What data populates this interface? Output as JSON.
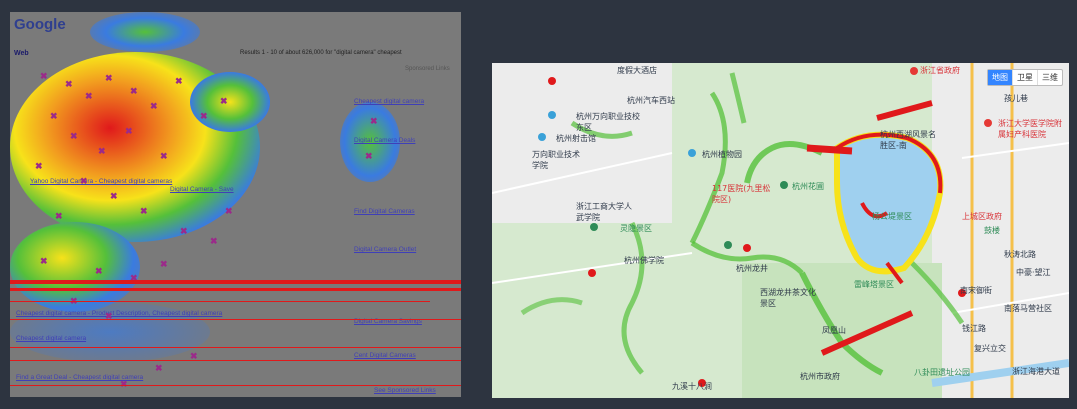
{
  "left": {
    "logo": "Google",
    "web_label": "Web",
    "results_info": "Results 1 - 10 of about 626,000 for \"digital camera\" cheapest",
    "sponsored_label": "Sponsored Links",
    "results": [
      "Yahoo Digital Camera - Cheapest digital cameras",
      "Digital Camera - Save",
      "Cheapest digital camera - Product Description, Cheapest digital camera",
      "Cheapest digital camera",
      "Find a Great Deal - Cheapest digital camera",
      "See Sponsored Links"
    ],
    "ads": [
      "Cheapest digital camera",
      "Digital Camera Deals",
      "Find Digital Cameras",
      "Digital Camera Outlet",
      "Digital Camera Savings",
      "Cent Digital Cameras"
    ]
  },
  "right": {
    "map_modes": [
      "地图",
      "卫星",
      "三维"
    ],
    "labels": [
      {
        "text": "度假大酒店",
        "cls": ""
      },
      {
        "text": "浙江省政府",
        "cls": "red"
      },
      {
        "text": "杭州万向职业技校东区",
        "cls": ""
      },
      {
        "text": "杭州汽车西站",
        "cls": ""
      },
      {
        "text": "杭州射击馆",
        "cls": ""
      },
      {
        "text": "万向职业技术学院",
        "cls": ""
      },
      {
        "text": "杭州植物园",
        "cls": ""
      },
      {
        "text": "杭州西湖风景名胜区-南",
        "cls": ""
      },
      {
        "text": "浙江大学医学院附属妇产科医院",
        "cls": "red"
      },
      {
        "text": "孩儿巷",
        "cls": ""
      },
      {
        "text": "浙江工商大学人武学院",
        "cls": ""
      },
      {
        "text": "灵隐景区",
        "cls": "green"
      },
      {
        "text": "117医院(九里松院区)",
        "cls": "red"
      },
      {
        "text": "杭州花圃",
        "cls": "green"
      },
      {
        "text": "杨公堤景区",
        "cls": "green"
      },
      {
        "text": "上城区政府",
        "cls": "red"
      },
      {
        "text": "鼓楼",
        "cls": "green"
      },
      {
        "text": "杭州佛学院",
        "cls": ""
      },
      {
        "text": "杭州龙井",
        "cls": ""
      },
      {
        "text": "西湖龙井茶文化景区",
        "cls": ""
      },
      {
        "text": "雷峰塔景区",
        "cls": "green"
      },
      {
        "text": "秋涛北路",
        "cls": ""
      },
      {
        "text": "中豪·望江",
        "cls": ""
      },
      {
        "text": "南宋御街",
        "cls": ""
      },
      {
        "text": "南落马营社区",
        "cls": ""
      },
      {
        "text": "钱江路",
        "cls": ""
      },
      {
        "text": "九溪十八涧",
        "cls": ""
      },
      {
        "text": "复兴立交",
        "cls": ""
      },
      {
        "text": "八卦田遗址公园",
        "cls": "green"
      },
      {
        "text": "浙江海港大道",
        "cls": ""
      },
      {
        "text": "杭州市政府",
        "cls": ""
      },
      {
        "text": "凤凰山",
        "cls": ""
      }
    ]
  },
  "colors": {
    "background": "#2d3440",
    "heat_red": "#e0191b",
    "heat_yellow": "#f7e21a",
    "heat_green": "#55c03a"
  }
}
